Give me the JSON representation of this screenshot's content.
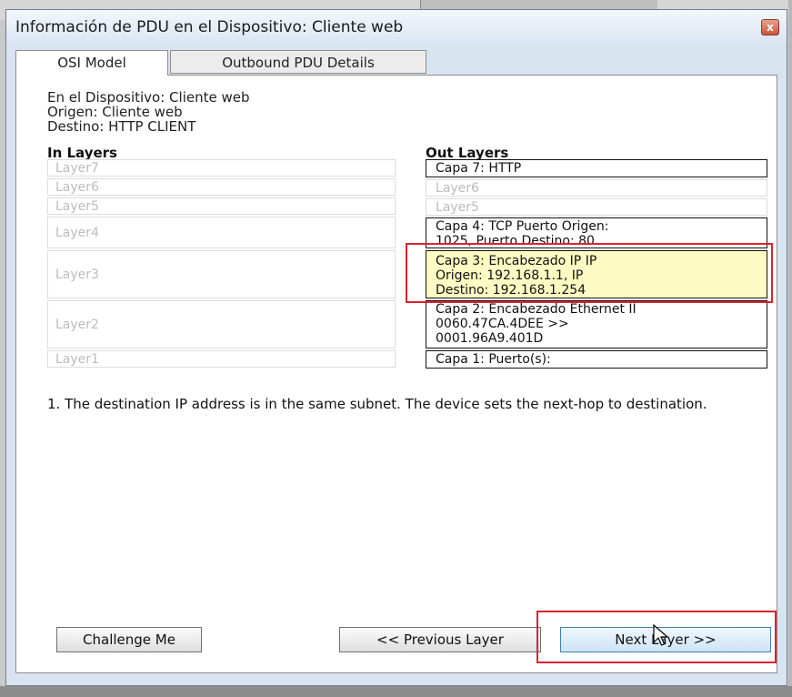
{
  "window": {
    "title": "Información de PDU en el Dispositivo: Cliente web",
    "close_label": "x"
  },
  "tabs": [
    {
      "label": "OSI Model",
      "active": true
    },
    {
      "label": "Outbound PDU Details",
      "active": false
    }
  ],
  "device_info": {
    "device": "En el Dispositivo: Cliente web",
    "source": "Origen: Cliente web",
    "destination": "Destino: HTTP CLIENT"
  },
  "in_layers": {
    "heading": "In Layers",
    "items": [
      "Layer7",
      "Layer6",
      "Layer5",
      "Layer4",
      "Layer3",
      "Layer2",
      "Layer1"
    ]
  },
  "out_layers": {
    "heading": "Out Layers",
    "items": [
      {
        "lines": [
          "Capa 7: HTTP"
        ],
        "state": "active"
      },
      {
        "lines": [
          "Layer6"
        ],
        "state": "inactive"
      },
      {
        "lines": [
          "Layer5"
        ],
        "state": "inactive"
      },
      {
        "lines": [
          "Capa 4: TCP Puerto Origen:",
          "1025, Puerto Destino: 80"
        ],
        "state": "active"
      },
      {
        "lines": [
          "Capa 3: Encabezado IP IP",
          "Origen: 192.168.1.1, IP",
          "Destino: 192.168.1.254"
        ],
        "state": "selected"
      },
      {
        "lines": [
          "Capa 2: Encabezado Ethernet II",
          "0060.47CA.4DEE >>",
          "0001.96A9.401D"
        ],
        "state": "active"
      },
      {
        "lines": [
          "Capa 1: Puerto(s):"
        ],
        "state": "active"
      }
    ]
  },
  "description": "1. The destination IP address is in the same subnet. The device sets the next-hop to destination.",
  "buttons": {
    "challenge": "Challenge Me",
    "previous": "<< Previous Layer",
    "next": "Next Layer >>"
  },
  "colors": {
    "selected_layer_bg": "#fdfbc3",
    "highlight_box": "#d9242e"
  }
}
